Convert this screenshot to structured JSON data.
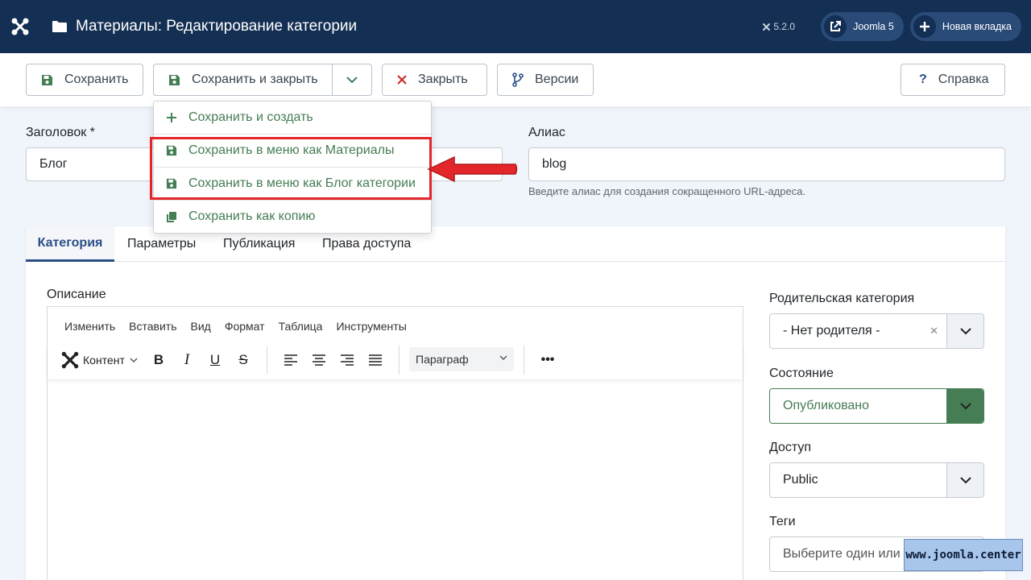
{
  "header": {
    "title": "Материалы: Редактирование категории",
    "version": "5.2.0",
    "pill_joomla": "Joomla 5",
    "pill_newtab": "Новая вкладка"
  },
  "toolbar": {
    "save": "Сохранить",
    "save_close": "Сохранить и закрыть",
    "close": "Закрыть",
    "versions": "Версии",
    "help": "Справка"
  },
  "dropdown": {
    "items": [
      "Сохранить и создать",
      "Сохранить в меню как Материалы",
      "Сохранить в меню как Блог категории",
      "Сохранить как копию"
    ]
  },
  "form": {
    "title_label": "Заголовок *",
    "title_value": "Блог",
    "alias_label": "Алиас",
    "alias_value": "blog",
    "alias_hint": "Введите алиас для создания сокращенного URL-адреса."
  },
  "tabs": [
    "Категория",
    "Параметры",
    "Публикация",
    "Права доступа"
  ],
  "editor": {
    "label": "Описание",
    "menu": [
      "Изменить",
      "Вставить",
      "Вид",
      "Формат",
      "Таблица",
      "Инструменты"
    ],
    "content_btn": "Контент",
    "paragraph": "Параграф"
  },
  "sidebar": {
    "parent_label": "Родительская категория",
    "parent_value": "- Нет родителя -",
    "state_label": "Состояние",
    "state_value": "Опубликовано",
    "access_label": "Доступ",
    "access_value": "Public",
    "tags_label": "Теги",
    "tags_placeholder": "Выберите один или"
  },
  "watermark": "www.joomla.center",
  "colors": {
    "header_bg": "#132f53",
    "accent_green": "#457d54",
    "highlight_red": "#e3262a",
    "tab_active": "#2a4f87"
  }
}
